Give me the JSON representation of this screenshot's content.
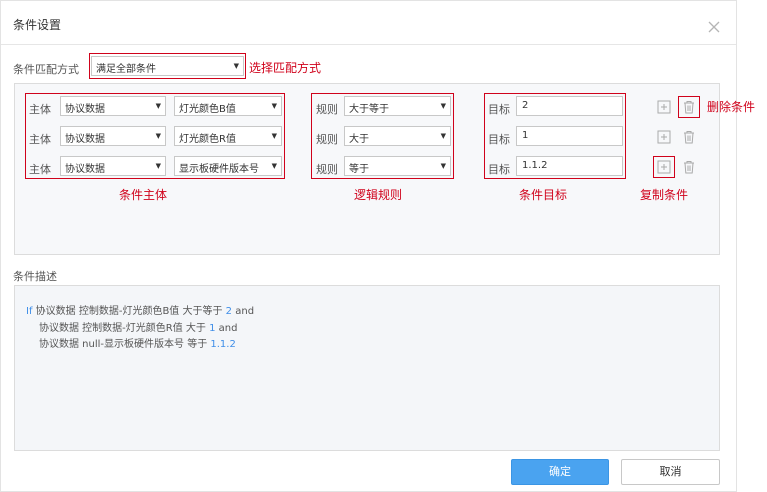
{
  "dialog": {
    "title": "条件设置",
    "close_icon": "close-icon"
  },
  "match": {
    "label": "条件匹配方式",
    "value": "满足全部条件",
    "annotation": "选择匹配方式"
  },
  "conditions": [
    {
      "subject_label": "主体",
      "subject_type": "协议数据",
      "subject_field": "灯光颜色B值",
      "rule_label": "规则",
      "rule": "大于等于",
      "target_label": "目标",
      "target": "2"
    },
    {
      "subject_label": "主体",
      "subject_type": "协议数据",
      "subject_field": "灯光颜色R值",
      "rule_label": "规则",
      "rule": "大于",
      "target_label": "目标",
      "target": "1"
    },
    {
      "subject_label": "主体",
      "subject_type": "协议数据",
      "subject_field": "显示板硬件版本号",
      "rule_label": "规则",
      "rule": "等于",
      "target_label": "目标",
      "target": "1.1.2"
    }
  ],
  "annotations": {
    "subject": "条件主体",
    "rule": "逻辑规则",
    "target": "条件目标",
    "delete": "删除条件",
    "copy": "复制条件"
  },
  "description": {
    "label": "条件描述",
    "lines": [
      {
        "prefix": "If",
        "text": " 协议数据 控制数据-灯光颜色B值 大于等于 ",
        "value": "2",
        "suffix": " and"
      },
      {
        "prefix": "",
        "text": "协议数据 控制数据-灯光颜色R值 大于 ",
        "value": "1",
        "suffix": " and"
      },
      {
        "prefix": "",
        "text": "协议数据 null-显示板硬件版本号 等于 ",
        "value": "1.1.2",
        "suffix": ""
      }
    ]
  },
  "buttons": {
    "confirm": "确定",
    "cancel": "取消"
  },
  "colors": {
    "annotation_red": "#d0021b",
    "primary_blue": "#4aa3f0",
    "value_blue": "#3f8ee8"
  },
  "icons": {
    "dropdown": "caret-down-icon",
    "add": "plus-square-icon",
    "delete": "trash-icon"
  }
}
